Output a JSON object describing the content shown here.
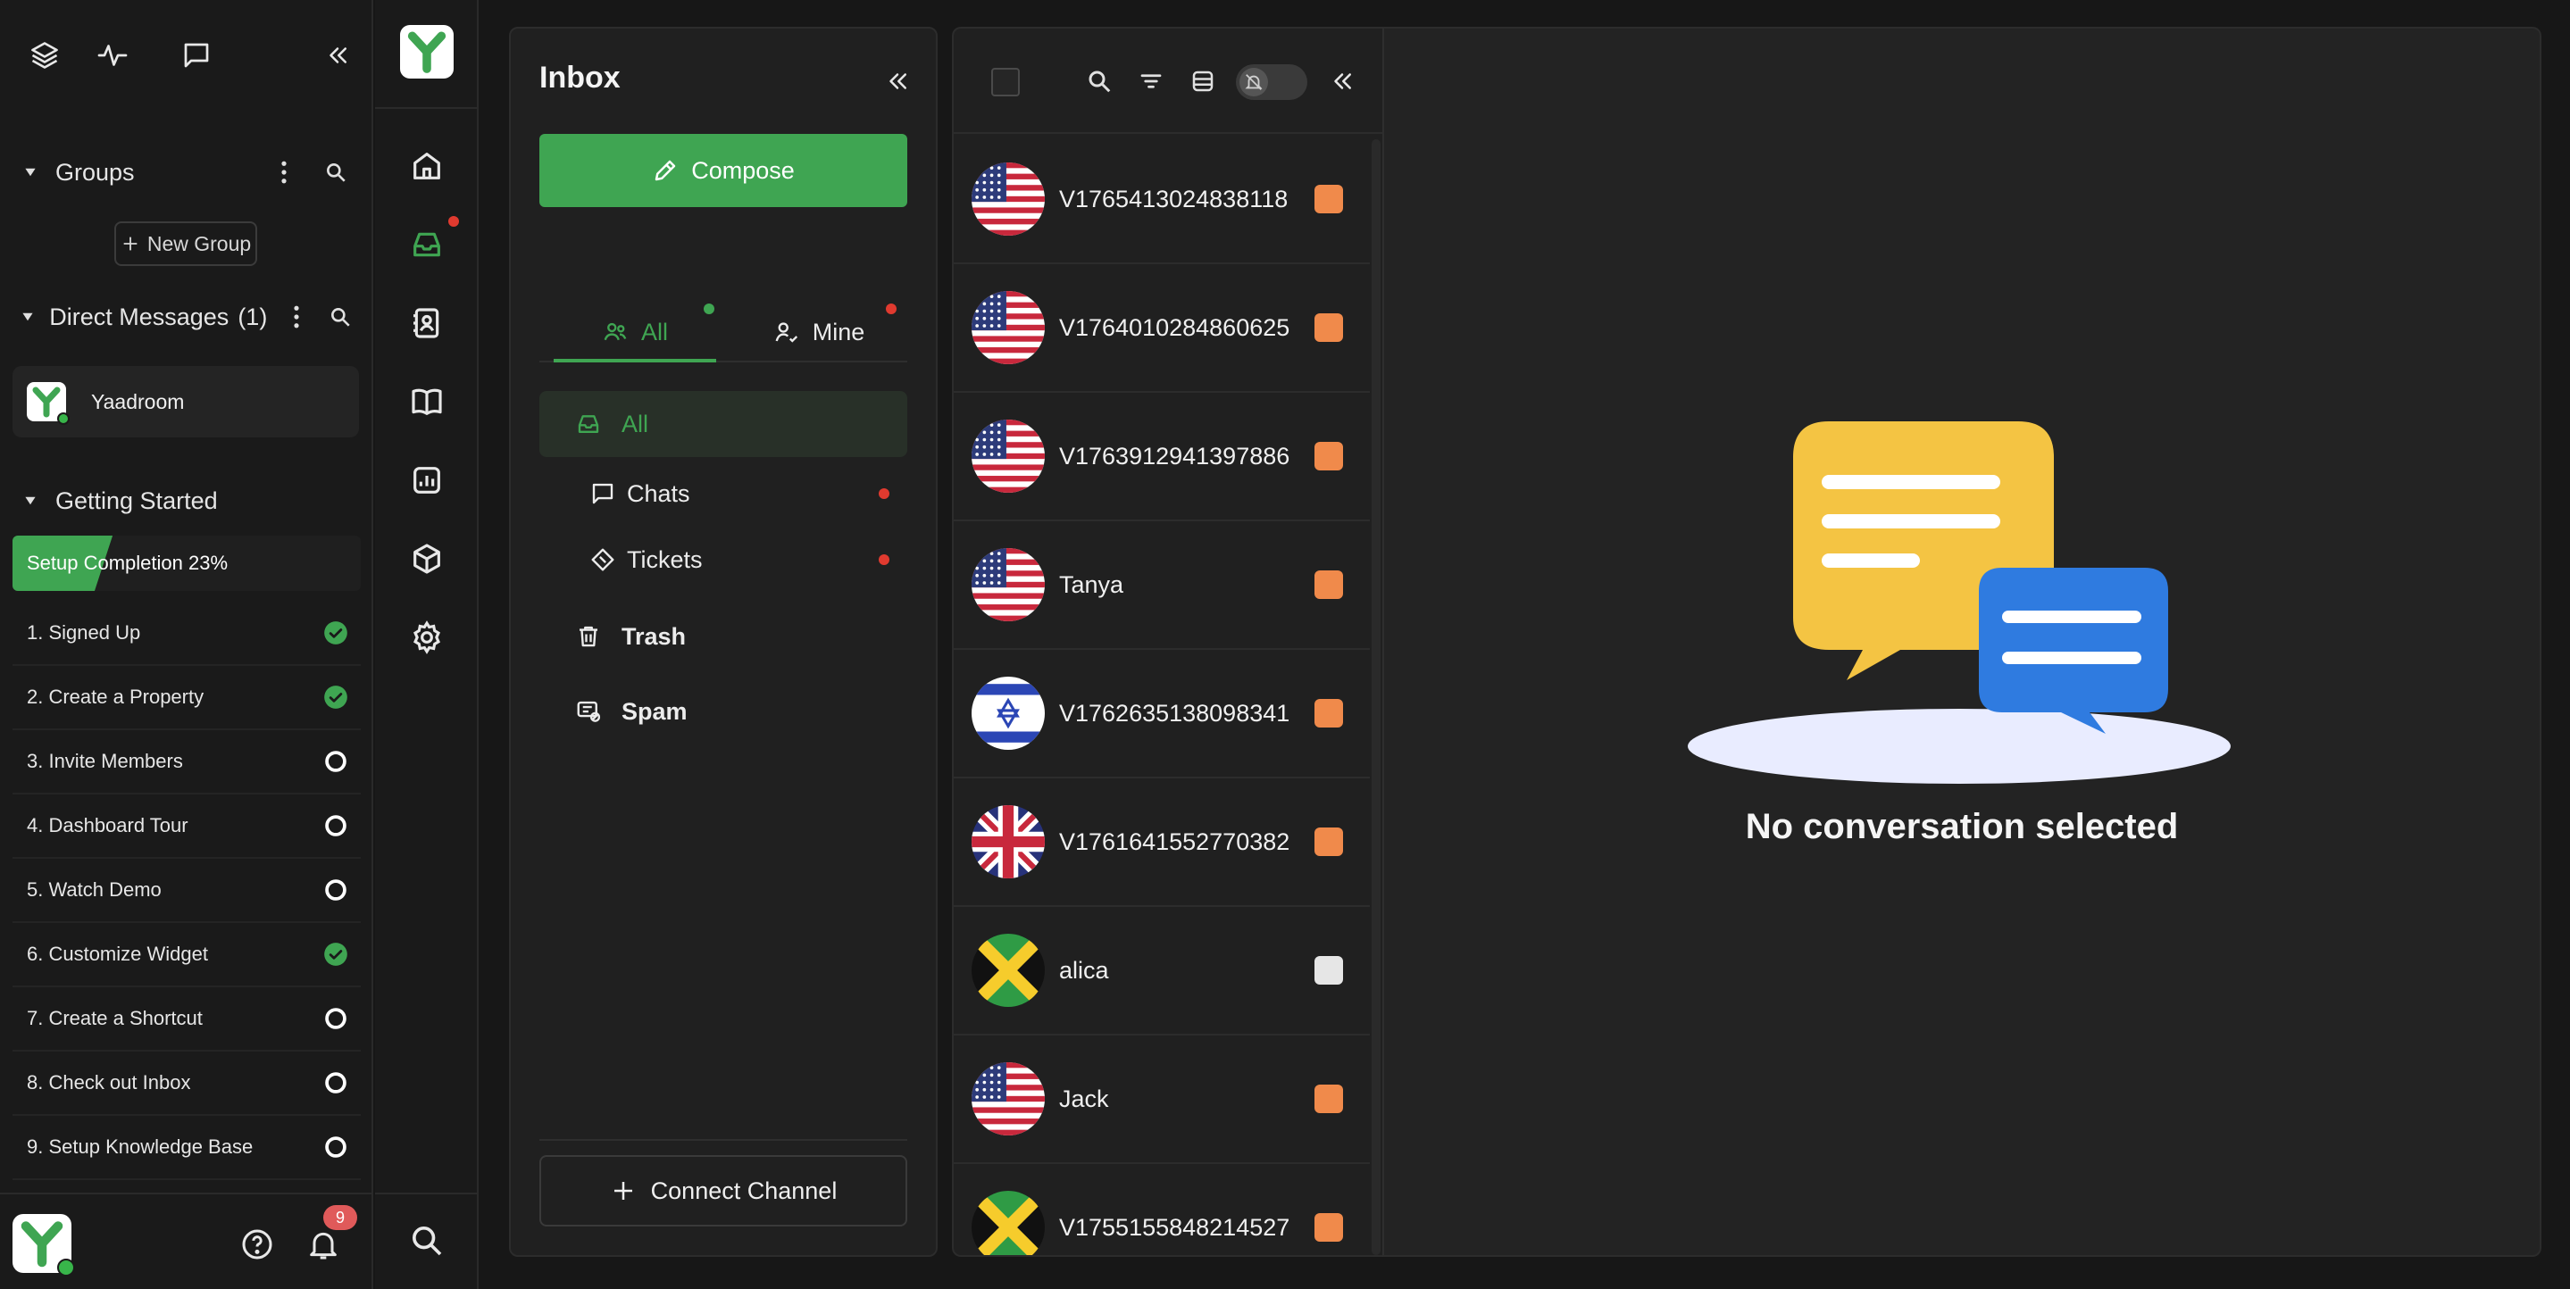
{
  "sidebar": {
    "groups": {
      "title": "Groups",
      "new_group_label": "New Group"
    },
    "direct_messages": {
      "title": "Direct Messages",
      "count": "(1)",
      "items": [
        {
          "name": "Yaadroom"
        }
      ]
    },
    "getting_started": {
      "title": "Getting Started",
      "progress_label": "Setup Completion 23%",
      "progress_percent": 23,
      "steps": [
        {
          "label": "1. Signed Up",
          "done": true
        },
        {
          "label": "2. Create a Property",
          "done": true
        },
        {
          "label": "3. Invite Members",
          "done": false
        },
        {
          "label": "4. Dashboard Tour",
          "done": false
        },
        {
          "label": "5. Watch Demo",
          "done": false
        },
        {
          "label": "6. Customize Widget",
          "done": true
        },
        {
          "label": "7. Create a Shortcut",
          "done": false
        },
        {
          "label": "8. Check out Inbox",
          "done": false
        },
        {
          "label": "9. Setup Knowledge Base",
          "done": false
        }
      ]
    },
    "footer": {
      "notification_count": "9"
    }
  },
  "inbox": {
    "title": "Inbox",
    "compose_label": "Compose",
    "tabs": [
      {
        "label": "All"
      },
      {
        "label": "Mine"
      }
    ],
    "nav": [
      {
        "label": "All"
      },
      {
        "label": "Chats"
      },
      {
        "label": "Tickets"
      },
      {
        "label": "Trash"
      },
      {
        "label": "Spam"
      }
    ],
    "connect_label": "Connect Channel"
  },
  "conversations": [
    {
      "name": "V1765413024838118",
      "flag": "us",
      "tag": "#f08a4b"
    },
    {
      "name": "V1764010284860625",
      "flag": "us",
      "tag": "#f08a4b"
    },
    {
      "name": "V1763912941397886",
      "flag": "us",
      "tag": "#f08a4b"
    },
    {
      "name": "Tanya",
      "flag": "us",
      "tag": "#f08a4b"
    },
    {
      "name": "V1762635138098341",
      "flag": "il",
      "tag": "#f08a4b"
    },
    {
      "name": "V1761641552770382",
      "flag": "gb",
      "tag": "#f08a4b"
    },
    {
      "name": "alica",
      "flag": "jm",
      "tag": "#e6e6e6"
    },
    {
      "name": "Jack",
      "flag": "us",
      "tag": "#f08a4b"
    },
    {
      "name": "V1755155848214527",
      "flag": "jm",
      "tag": "#f08a4b"
    }
  ],
  "detail": {
    "empty_text": "No conversation selected"
  },
  "colors": {
    "accent": "#3fa552",
    "alert": "#e03a2f",
    "tag_orange": "#f08a4b",
    "bubble_yellow": "#f4c443",
    "bubble_blue": "#2f7be0"
  }
}
